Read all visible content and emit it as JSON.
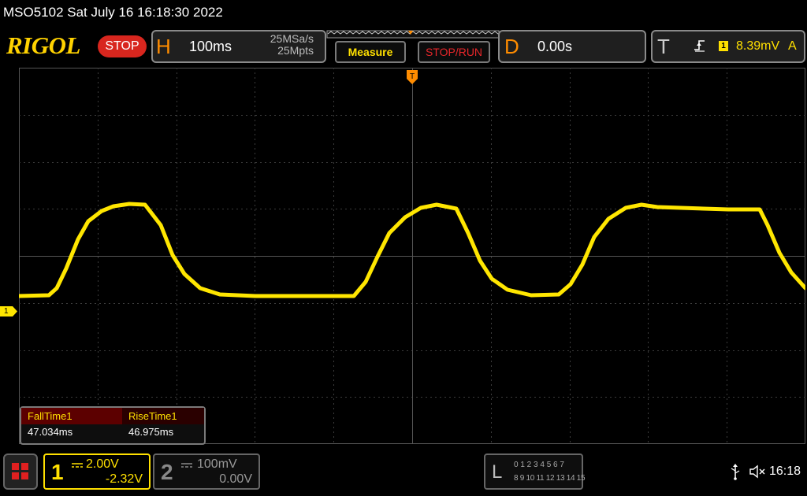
{
  "header": {
    "model_datetime": "MSO5102  Sat July 16 16:18:30 2022",
    "brand": "RIGOL",
    "run_state": "STOP"
  },
  "horizontal": {
    "letter": "H",
    "timebase": "100ms",
    "sample_rate": "25MSa/s",
    "memory_depth": "25Mpts"
  },
  "buttons": {
    "measure": "Measure",
    "stop_run": "STOP/RUN"
  },
  "delay": {
    "letter": "D",
    "value": "0.00s"
  },
  "trigger": {
    "letter": "T",
    "channel": "1",
    "level": "8.39mV",
    "mode": "A"
  },
  "ch1_marker_label": "1",
  "measurements": {
    "items": [
      {
        "name": "FallTime1",
        "value": "47.034ms"
      },
      {
        "name": "RiseTime1",
        "value": "46.975ms"
      }
    ]
  },
  "channel1": {
    "number": "1",
    "scale": "2.00V",
    "offset": "-2.32V"
  },
  "channel2": {
    "number": "2",
    "scale": "100mV",
    "offset": "0.00V"
  },
  "logic": {
    "letter": "L",
    "row1": "0 1 2 3  4 5 6 7",
    "row2": "8 9 10 11 12 13 14 15"
  },
  "status": {
    "time": "16:18"
  },
  "colors": {
    "trace": "#ffe600",
    "accent": "#ff8c00",
    "stop": "#d8261e"
  }
}
